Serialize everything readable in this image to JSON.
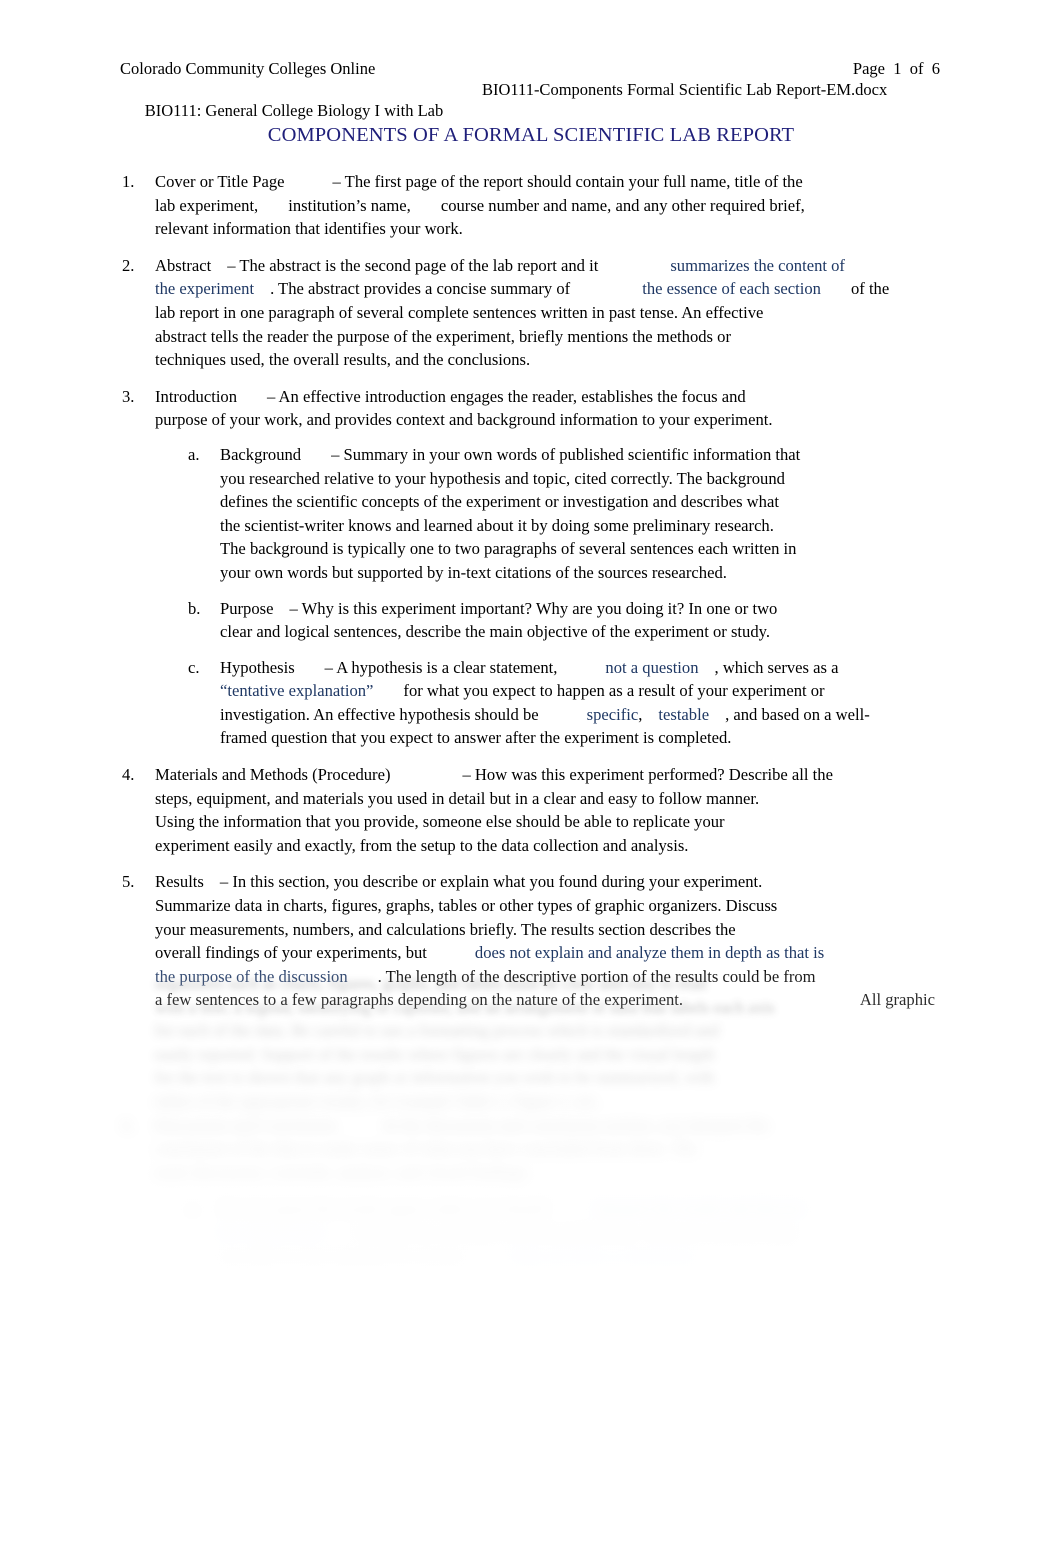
{
  "header": {
    "institution": "Colorado Community Colleges Online",
    "course": "BIO111: General College Biology I with Lab",
    "filename": "BIO111-Components Formal Scientific Lab Report-EM.docx",
    "page_label": "Page  1  of  6"
  },
  "title": "COMPONENTS OF A FORMAL SCIENTIFIC LAB REPORT",
  "colors": {
    "title_navy": "#1f1f7a",
    "accent_blue": "#1f3864",
    "link_blue": "#4472c4",
    "body_black": "#000000"
  },
  "items": [
    {
      "number": "1.",
      "term": "Cover or Title Page",
      "t1": "– The first page of the report should contain your full name, title of the",
      "t2": "lab experiment,",
      "t3": "institution’s name,",
      "t4": "course number and name, and any other required brief,",
      "t5": "relevant information that identifies your work."
    },
    {
      "number": "2.",
      "term": "Abstract",
      "t1": "– The abstract is the second page of the lab report and it",
      "blue1": "summarizes the content of",
      "blue2": "the experiment",
      "t2": ".  The abstract provides a concise summary of",
      "blue3": "the essence of each section",
      "t3": "of the",
      "t4": "lab report in one paragraph of several complete sentences written in past tense. An effective",
      "t5": "abstract tells the reader the purpose of the experiment, briefly mentions the methods or",
      "t6": "techniques used, the overall results, and the conclusions."
    },
    {
      "number": "3.",
      "term": "Introduction",
      "t1": "– An effective introduction engages the reader, establishes the focus and",
      "t2": "purpose of your work, and provides context and background information to your experiment.",
      "subitems": [
        {
          "letter": "a.",
          "term": "Background",
          "t1": "– Summary in your own words of published scientific information that",
          "t2": "you researched relative to your hypothesis and topic, cited correctly. The background",
          "t3": "defines the scientific concepts of the experiment or investigation and describes what",
          "t4": "the scientist-writer knows and learned about it by doing some preliminary research.",
          "t5": "The background is typically one to two paragraphs of several sentences each written in",
          "t6": "your own words but supported by in-text citations of the sources researched."
        },
        {
          "letter": "b.",
          "term": "Purpose",
          "t1": "– Why is this experiment important? Why are you doing it? In one or two",
          "t2": "clear and logical sentences, describe the main objective of the experiment or study."
        },
        {
          "letter": "c.",
          "term": "Hypothesis",
          "t1": "– A hypothesis is a clear statement,",
          "blue1": "not a question",
          "t2": ", which serves as a",
          "blue2": "“tentative explanation”",
          "t3": "for what you expect to happen as a result of your experiment or",
          "t4": "investigation. An effective hypothesis should be",
          "blue3": "specific",
          "t5": ",",
          "blue4": "testable",
          "t6": ", and based on a well-",
          "t7": "framed question that you expect to answer after the experiment is completed."
        }
      ]
    },
    {
      "number": "4.",
      "term": "Materials and Methods (Procedure)",
      "t1": "– How was this experiment performed? Describe all the",
      "t2": "steps, equipment, and materials you used in detail but in a clear and easy to follow manner.",
      "t3": "Using the information that you provide, someone else should be able to replicate your",
      "t4": "experiment easily and exactly, from the setup to the data collection and analysis."
    },
    {
      "number": "5.",
      "term": "Results",
      "t1": "– In this section, you describe or explain what you found during your experiment.",
      "t2": "Summarize data in charts, figures, graphs, tables or other types of graphic organizers. Discuss",
      "t3": "your measurements, numbers, and calculations briefly. The results section describes the",
      "t4": "overall findings of your experiments, but",
      "blue1": "does not explain and analyze them in depth as that is",
      "blue2": "the purpose of the discussion",
      "t5": ".   The length of the descriptive portion of the results could be from",
      "t6": "a few sentences to a few paragraphs depending on the nature of the experiment.",
      "t7": "All graphic"
    }
  ],
  "obscured": {
    "note": "lower portion of page is blurred / illegible",
    "lines": [
      "organizers such as charts, figures, graphs, and tables must be clear and easy to read",
      "with a title, a legend, identifying of captions, and an arrangement of data that labels each axis",
      "for  each  of the data.  Be careful to use a formatting process which is standardized and",
      "easily reported. Support of the results where figures  are clearly and the visual length",
      "for the text is shown that any graph or information you wish to be summarized, with",
      "tables of the appropriate results, for example  Table 1,  Figure 1,  etc."
    ],
    "item6": {
      "number": "6.",
      "term": "Discussion and Conclusion",
      "t1": "In the discussion and conclusion section, you interpret the",
      "t2": "conclusion of the data to make sense of what you have concluded from them. The",
      "t3": "main discussion, conclude, analyze, and closed findings."
    },
    "item6_sub": {
      "letter": "a.",
      "t1": "Do not repeat the results again, rather you should",
      "link1": "interpret the results and discuss",
      "link2": "the significance",
      "t2": "of what you conclude with the preliminary. Whereas research help",
      "t3": "you able to your standard for section",
      "link3": "help you draw a conclusion"
    }
  }
}
